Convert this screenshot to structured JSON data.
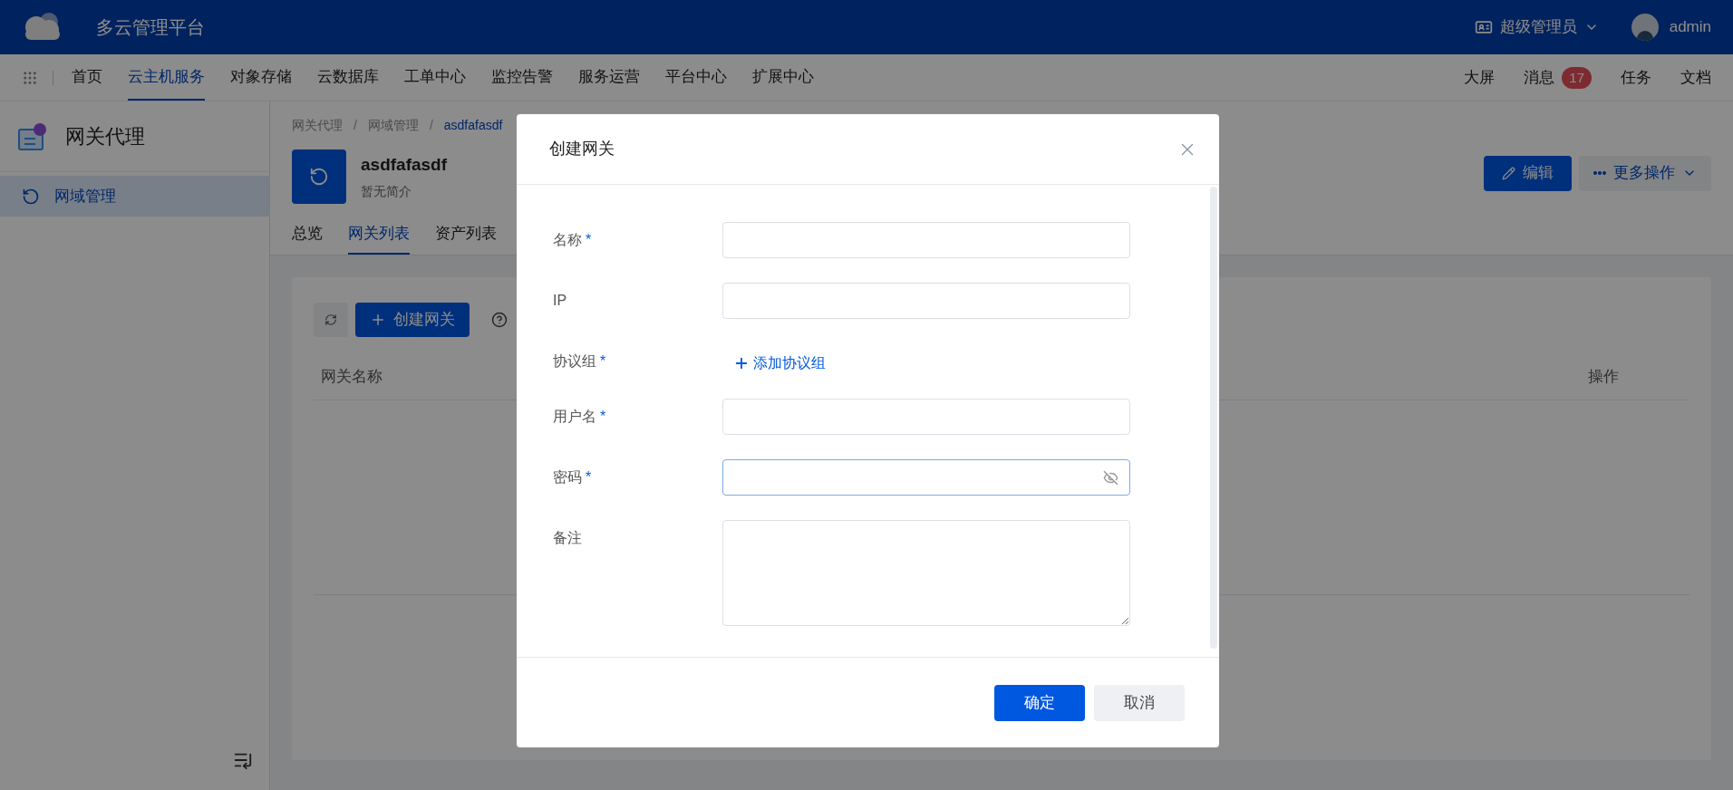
{
  "header": {
    "title": "多云管理平台",
    "role": "超级管理员",
    "user": "admin"
  },
  "nav": {
    "items": [
      {
        "label": "首页",
        "selected": false
      },
      {
        "label": "云主机服务",
        "selected": true
      },
      {
        "label": "对象存储",
        "selected": false
      },
      {
        "label": "云数据库",
        "selected": false
      },
      {
        "label": "工单中心",
        "selected": false
      },
      {
        "label": "监控告警",
        "selected": false
      },
      {
        "label": "服务运营",
        "selected": false
      },
      {
        "label": "平台中心",
        "selected": false
      },
      {
        "label": "扩展中心",
        "selected": false
      }
    ],
    "right": [
      {
        "label": "大屏"
      },
      {
        "label": "消息",
        "badge": "17"
      },
      {
        "label": "任务"
      },
      {
        "label": "文档"
      }
    ]
  },
  "sidebar": {
    "title": "网关代理",
    "items": [
      {
        "label": "网域管理",
        "selected": true
      }
    ]
  },
  "breadcrumb": {
    "separator": "/",
    "items": [
      "网关代理",
      "网域管理",
      "asdfafasdf"
    ]
  },
  "resource": {
    "name": "asdfafasdf",
    "description": "暂无简介",
    "actions": [
      {
        "label": "编辑",
        "kind": "primary"
      },
      {
        "label": "更多操作",
        "kind": "dropdown"
      }
    ]
  },
  "tabs": [
    {
      "label": "总览",
      "selected": false
    },
    {
      "label": "网关列表",
      "selected": true
    },
    {
      "label": "资产列表",
      "selected": false
    }
  ],
  "toolbar": {
    "create_button": "创建网关"
  },
  "table": {
    "columns": [
      "网关名称",
      "操作"
    ]
  },
  "dialog": {
    "title": "创建网关",
    "fields": [
      {
        "label": "名称",
        "required_mark": "*",
        "kind": "input",
        "focused": false
      },
      {
        "label": "IP",
        "kind": "input",
        "focused": false
      },
      {
        "label": "协议组",
        "required_mark": "*",
        "kind": "add",
        "action": "添加协议组"
      },
      {
        "label": "用户名",
        "required_mark": "*",
        "kind": "input",
        "focused": false
      },
      {
        "label": "密码",
        "required_mark": "*",
        "kind": "password",
        "focused": true
      },
      {
        "label": "备注",
        "kind": "textarea",
        "focused": false
      }
    ],
    "buttons": [
      {
        "label": "确定",
        "kind": "primary"
      },
      {
        "label": "取消",
        "kind": "secondary"
      }
    ]
  }
}
